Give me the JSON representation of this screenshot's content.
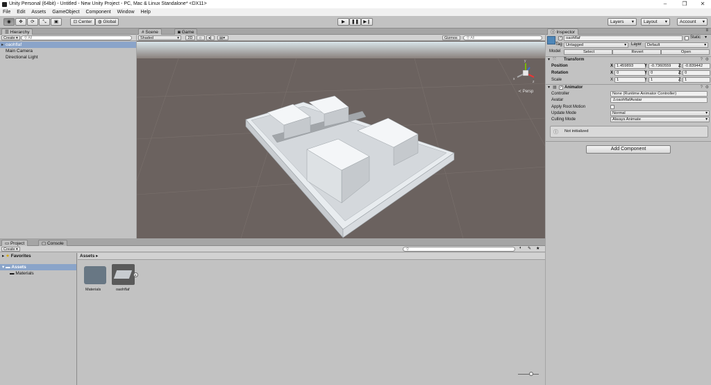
{
  "window": {
    "title": "Unity Personal (64bit) - Untitled - New Unity Project - PC, Mac & Linux Standalone* <DX11>",
    "controls": [
      "–",
      "❐",
      "✕"
    ]
  },
  "menu": [
    "File",
    "Edit",
    "Assets",
    "GameObject",
    "Component",
    "Window",
    "Help"
  ],
  "toolbar": {
    "tools": [
      "hand",
      "move",
      "rotate",
      "scale",
      "rect"
    ],
    "pivot": "Center",
    "space": "Global",
    "layers": "Layers",
    "layout": "Layout",
    "account": "Account"
  },
  "hierarchy": {
    "tab": "Hierarchy",
    "create": "Create",
    "search_placeholder": "All",
    "items": [
      "oaohflaf",
      "Main Camera",
      "Directional Light"
    ]
  },
  "scene": {
    "tabs": [
      "Scene",
      "Game"
    ],
    "shading": "Shaded",
    "mode2d": "2D",
    "gizmos": "Gizmos",
    "search_placeholder": "All",
    "persp": "Persp",
    "axes": {
      "y": "y",
      "x": "x",
      "z": "z"
    }
  },
  "inspector": {
    "tab": "Inspector",
    "name": "oaohflaf",
    "static": "Static",
    "tag_label": "Tag",
    "tag": "Untagged",
    "layer_label": "Layer",
    "layer": "Default",
    "model_label": "Model",
    "model_buttons": [
      "Select",
      "Revert",
      "Open"
    ],
    "transform": {
      "title": "Transform",
      "rows": [
        {
          "label": "Position",
          "x": "1.459893",
          "y": "-0.7360559",
          "z": "-0.839442"
        },
        {
          "label": "Rotation",
          "x": "0",
          "y": "0",
          "z": "0"
        },
        {
          "label": "Scale",
          "x": "1",
          "y": "1",
          "z": "1"
        }
      ]
    },
    "animator": {
      "title": "Animator",
      "controller_label": "Controller",
      "controller": "None (Runtime Animator Controller)",
      "avatar_label": "Avatar",
      "avatar": "oaohflafAvatar",
      "root_motion_label": "Apply Root Motion",
      "update_label": "Update Mode",
      "update": "Normal",
      "culling_label": "Culling Mode",
      "culling": "Always Animate",
      "info": "Not initialized"
    },
    "add_component": "Add Component"
  },
  "project": {
    "tabs": [
      "Project",
      "Console"
    ],
    "create": "Create",
    "tree": {
      "favorites": "Favorites",
      "assets": "Assets",
      "materials": "Materials"
    },
    "breadcrumb": "Assets",
    "assets": [
      "Materials",
      "oaohflaf"
    ]
  }
}
